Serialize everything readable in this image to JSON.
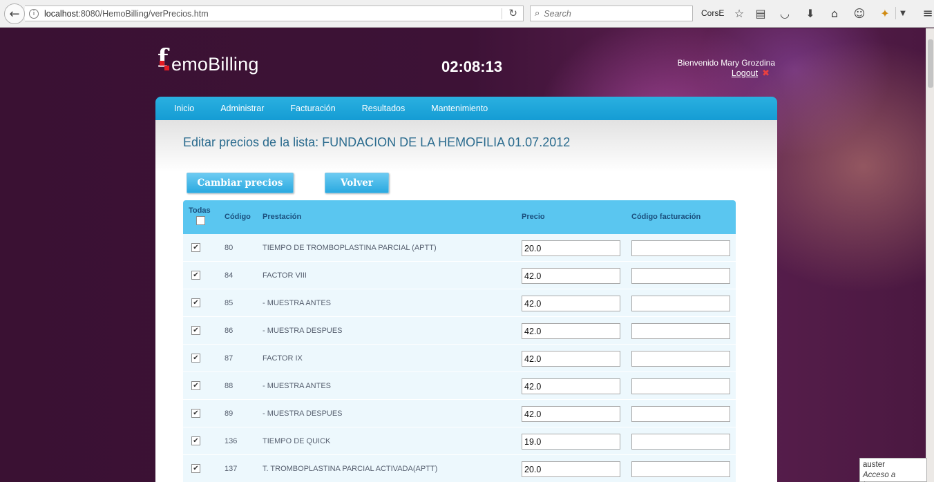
{
  "browser": {
    "url_host": "localhost",
    "url_rest": ":8080/HemoBilling/verPrecios.htm",
    "search_placeholder": "Search",
    "profile_label": "CorsE"
  },
  "header": {
    "logo_text": "emoBilling",
    "clock": "02:08:13",
    "welcome": "Bienvenido Mary Grozdina",
    "logout": "Logout"
  },
  "nav": {
    "items": [
      "Inicio",
      "Administrar",
      "Facturación",
      "Resultados",
      "Mantenimiento"
    ]
  },
  "main": {
    "title": "Editar precios de la lista: FUNDACION DE LA HEMOFILIA 01.07.2012",
    "btn_change": "Cambiar precios",
    "btn_back": "Volver",
    "columns": {
      "todas": "Todas",
      "codigo": "Código",
      "prestacion": "Prestación",
      "precio": "Precio",
      "codigo_facturacion": "Código facturación"
    },
    "rows": [
      {
        "code": "80",
        "name": "TIEMPO DE TROMBOPLASTINA PARCIAL (APTT)",
        "price": "20.0",
        "billing_code": ""
      },
      {
        "code": "84",
        "name": "FACTOR VIII",
        "price": "42.0",
        "billing_code": ""
      },
      {
        "code": "85",
        "name": "- MUESTRA ANTES",
        "price": "42.0",
        "billing_code": ""
      },
      {
        "code": "86",
        "name": "- MUESTRA DESPUES",
        "price": "42.0",
        "billing_code": ""
      },
      {
        "code": "87",
        "name": "FACTOR IX",
        "price": "42.0",
        "billing_code": ""
      },
      {
        "code": "88",
        "name": "- MUESTRA ANTES",
        "price": "42.0",
        "billing_code": ""
      },
      {
        "code": "89",
        "name": "- MUESTRA DESPUES",
        "price": "42.0",
        "billing_code": ""
      },
      {
        "code": "136",
        "name": "TIEMPO DE QUICK",
        "price": "19.0",
        "billing_code": ""
      },
      {
        "code": "137",
        "name": "T. TROMBOPLASTINA PARCIAL ACTIVADA(APTT)",
        "price": "20.0",
        "billing_code": ""
      }
    ]
  },
  "status_tooltip": {
    "line1": "auster",
    "line2": "Acceso a Internet"
  },
  "icons": [
    "back-arrow-icon",
    "info-icon",
    "reload-icon",
    "search-icon",
    "star-icon",
    "reader-icon",
    "pocket-icon",
    "download-icon",
    "home-icon",
    "chat-icon",
    "extension-icon",
    "dropdown-icon",
    "menu-icon",
    "close-icon"
  ],
  "colors": {
    "nav_blue": "#159cd4",
    "table_header": "#5ac6f0",
    "title": "#2a6b8e",
    "logo_red": "#e31b23"
  }
}
